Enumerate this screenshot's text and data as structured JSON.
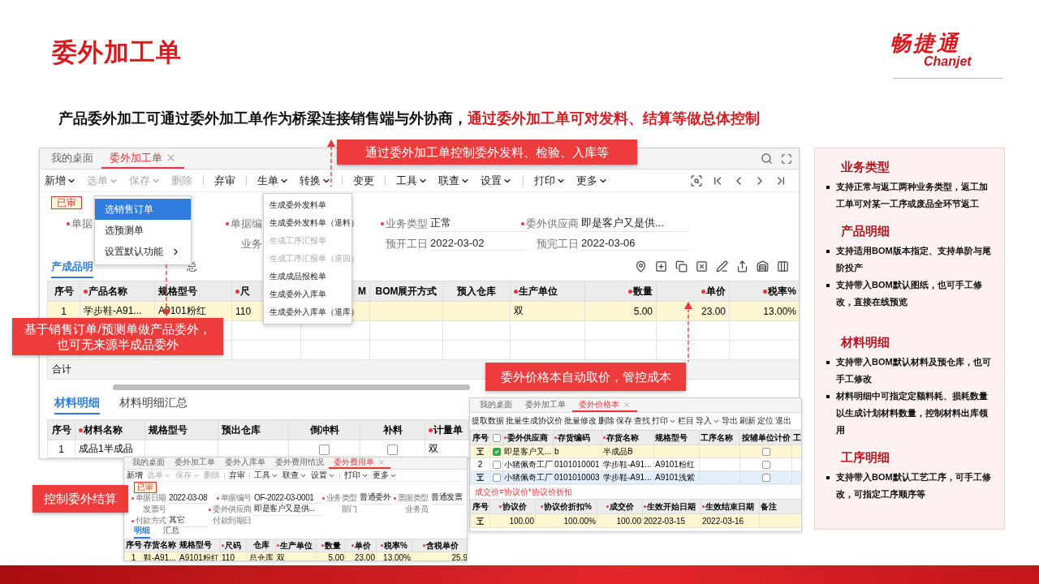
{
  "slide": {
    "title": "委外加工单",
    "logo_name": "畅捷通",
    "logo_latin": "Chanjet",
    "lead": "产品委外加工可通过委外加工单作为桥梁连接销售端与外协商，",
    "lead_highlight": "通过委外加工单可对发料、结算等做总体控制"
  },
  "main_window": {
    "tabs": [
      {
        "label": "我的桌面",
        "selected": false,
        "closable": false
      },
      {
        "label": "委外加工单",
        "selected": true,
        "closable": true
      }
    ],
    "toolbar": [
      {
        "label": "新增",
        "dropdown": true,
        "disabled": false,
        "divider": false
      },
      {
        "label": "选单",
        "dropdown": true,
        "disabled": true,
        "divider": false
      },
      {
        "label": "保存",
        "dropdown": true,
        "disabled": true,
        "divider": false
      },
      {
        "label": "删除",
        "dropdown": false,
        "disabled": true,
        "divider": true
      },
      {
        "label": "弃审",
        "dropdown": false,
        "disabled": false,
        "divider": true
      },
      {
        "label": "生单",
        "dropdown": true,
        "disabled": false,
        "divider": false
      },
      {
        "label": "转换",
        "dropdown": true,
        "disabled": false,
        "divider": true
      },
      {
        "label": "变更",
        "dropdown": false,
        "disabled": false,
        "divider": true
      },
      {
        "label": "工具",
        "dropdown": true,
        "disabled": false,
        "divider": false
      },
      {
        "label": "联查",
        "dropdown": true,
        "disabled": false,
        "divider": false
      },
      {
        "label": "设置",
        "dropdown": true,
        "disabled": false,
        "divider": true
      },
      {
        "label": "打印",
        "dropdown": true,
        "disabled": false,
        "divider": false
      },
      {
        "label": "更多",
        "dropdown": true,
        "disabled": false,
        "divider": false
      }
    ],
    "status": "已审",
    "form_columns": [
      [
        {
          "label": "单据",
          "required": true
        }
      ],
      [
        {
          "label": "单据编",
          "required": true
        },
        {
          "label": "业务",
          "required": false
        }
      ],
      [
        {
          "label": "业务类型",
          "required": true,
          "value": "正常"
        },
        {
          "label": "预开工日",
          "required": false,
          "value": "2022-03-02"
        }
      ],
      [
        {
          "label": "委外供应商",
          "required": true,
          "value": "即是客户又是供..."
        },
        {
          "label": "预完工日",
          "required": false,
          "value": "2022-03-06"
        }
      ]
    ],
    "select_menu": [
      {
        "label": "选销售订单",
        "selected": true,
        "submenu": false
      },
      {
        "label": "选预测单",
        "selected": false,
        "submenu": false
      },
      {
        "label": "设置默认功能",
        "selected": false,
        "submenu": true
      }
    ],
    "generate_menu": [
      {
        "label": "生成委外发料单",
        "disabled": false
      },
      {
        "label": "生成委外发料单（退料）",
        "disabled": false
      },
      {
        "label": "生成工序汇报单",
        "disabled": true
      },
      {
        "label": "生成工序汇报单（退回）",
        "disabled": true
      },
      {
        "label": "生成成品报检单",
        "disabled": false
      },
      {
        "label": "生成委外入库单",
        "disabled": false
      },
      {
        "label": "生成委外入库单（退库）",
        "disabled": false
      }
    ],
    "detail_tabs": [
      {
        "label": "产成品明",
        "selected": true
      },
      {
        "label": "总",
        "selected": false
      }
    ],
    "product_table": {
      "columns": [
        {
          "label": "序号",
          "required": false
        },
        {
          "label": "产品名称",
          "required": true
        },
        {
          "label": "规格型号",
          "required": false
        },
        {
          "label": "尺",
          "required": true
        },
        {
          "label": "M",
          "required": false
        },
        {
          "label": "BOM展开方式",
          "required": false
        },
        {
          "label": "预入仓库",
          "required": false
        },
        {
          "label": "生产单位",
          "required": true
        },
        {
          "label": "数量",
          "required": true
        },
        {
          "label": "单价",
          "required": true
        },
        {
          "label": "税率%",
          "required": true
        }
      ],
      "rows": [
        {
          "current": true,
          "cells": [
            "1",
            "学步鞋-A91...",
            "A9101粉红",
            "110",
            null,
            null,
            null,
            "双",
            "5.00",
            "23.00",
            "13.00%"
          ]
        }
      ],
      "total_label": "合计"
    },
    "material_tabs": [
      {
        "label": "材料明细",
        "selected": true
      },
      {
        "label": "材料明细汇总",
        "selected": false
      }
    ],
    "material_table": {
      "columns": [
        {
          "label": "序号",
          "required": false
        },
        {
          "label": "材料名称",
          "required": true
        },
        {
          "label": "规格型号",
          "required": false
        },
        {
          "label": "预出仓库",
          "required": false
        },
        {
          "label": "倒冲料",
          "required": false
        },
        {
          "label": "补料",
          "required": false
        },
        {
          "label": "计量单",
          "required": true
        }
      ],
      "rows": [
        {
          "current": false,
          "cells": [
            "1",
            "成品1半成品",
            null,
            null,
            false,
            false,
            "双"
          ]
        }
      ]
    }
  },
  "price_window": {
    "tabs": [
      {
        "label": "我的桌面",
        "selected": false,
        "closable": false
      },
      {
        "label": "委外加工单",
        "selected": false,
        "closable": false
      },
      {
        "label": "委外价格本",
        "selected": true,
        "closable": true
      }
    ],
    "toolbar": [
      {
        "label": "提取数据",
        "dropdown": false
      },
      {
        "label": "批量生成协议价",
        "dropdown": false
      },
      {
        "label": "批量修改",
        "dropdown": false
      },
      {
        "label": "删除",
        "dropdown": false
      },
      {
        "label": "保存",
        "dropdown": false
      },
      {
        "label": "查找",
        "dropdown": false
      },
      {
        "label": "打印",
        "dropdown": true
      },
      {
        "label": "栏目",
        "dropdown": false
      },
      {
        "label": "导入",
        "dropdown": true
      },
      {
        "label": "导出",
        "dropdown": false
      },
      {
        "label": "刷新",
        "dropdown": false
      },
      {
        "label": "定位",
        "dropdown": false
      },
      {
        "label": "退出",
        "dropdown": false
      }
    ],
    "price_table": {
      "columns": [
        {
          "label": "序号",
          "required": false
        },
        {
          "checked": false
        },
        {
          "label": "委外供应商",
          "required": true
        },
        {
          "label": "存货编码",
          "required": true
        },
        {
          "label": "存货名称",
          "required": true
        },
        {
          "label": "规格型号",
          "required": false
        },
        {
          "label": "工序名称",
          "required": false
        },
        {
          "label": "按辅单位计价",
          "required": false
        },
        {
          "label": "工",
          "required": false
        }
      ],
      "rows": [
        {
          "marker": true,
          "current": true,
          "selected": false,
          "cells": [
            null,
            true,
            "即是客户又...",
            "b",
            "半成品B",
            null,
            null,
            false,
            null
          ]
        },
        {
          "marker": false,
          "current": false,
          "selected": false,
          "cells": [
            "2",
            false,
            "小猪佩奇工厂",
            "0101010001",
            "学步鞋-A91...",
            "A9101粉红",
            null,
            false,
            null
          ]
        },
        {
          "marker": true,
          "current": false,
          "selected": true,
          "cells": [
            null,
            false,
            "小猪佩奇工厂",
            "0101010003",
            "学步鞋-A91...",
            "A9101浅紫",
            null,
            false,
            null
          ]
        }
      ]
    },
    "formula_note": "成交价=协议价*协议价折扣",
    "agreement_table": {
      "columns": [
        {
          "label": "序号",
          "required": false
        },
        {
          "label": "协议价",
          "required": true
        },
        {
          "label": "协议价折扣%",
          "required": true
        },
        {
          "label": "成交价",
          "required": true
        },
        {
          "label": "生效开始日期",
          "required": true
        },
        {
          "label": "生效结束日期",
          "required": true
        },
        {
          "label": "备注",
          "required": false
        }
      ],
      "rows": [
        {
          "marker": true,
          "current": true,
          "cells": [
            null,
            "100.00",
            "100.00%",
            "100.00",
            "2022-03-15",
            "2022-03-16",
            null
          ]
        }
      ]
    }
  },
  "fee_window": {
    "tabs": [
      {
        "label": "我的桌面",
        "selected": false,
        "closable": false
      },
      {
        "label": "委外加工单",
        "selected": false,
        "closable": false
      },
      {
        "label": "委外入库单",
        "selected": false,
        "closable": false
      },
      {
        "label": "委外费用情况",
        "selected": false,
        "closable": false
      },
      {
        "label": "委外费用单",
        "selected": true,
        "closable": true
      }
    ],
    "toolbar": [
      {
        "label": "新增",
        "dropdown": false,
        "disabled": false,
        "divider": false
      },
      {
        "label": "选单",
        "dropdown": true,
        "disabled": true,
        "divider": false
      },
      {
        "label": "保存",
        "dropdown": true,
        "disabled": true,
        "divider": false
      },
      {
        "label": "删除",
        "dropdown": false,
        "disabled": true,
        "divider": true
      },
      {
        "label": "弃审",
        "dropdown": false,
        "disabled": false,
        "divider": true
      },
      {
        "label": "工具",
        "dropdown": true,
        "disabled": false,
        "divider": false
      },
      {
        "label": "联查",
        "dropdown": true,
        "disabled": false,
        "divider": false
      },
      {
        "label": "设置",
        "dropdown": true,
        "disabled": false,
        "divider": true
      },
      {
        "label": "打印",
        "dropdown": true,
        "disabled": false,
        "divider": false
      },
      {
        "label": "更多",
        "dropdown": true,
        "disabled": false,
        "divider": false
      }
    ],
    "status": "已审",
    "form_columns": [
      [
        {
          "label": "单据日期",
          "required": true,
          "value": "2022-03-08"
        },
        {
          "label": "发票号",
          "required": false
        },
        {
          "label": "付款方式",
          "required": true,
          "value": "其它"
        }
      ],
      [
        {
          "label": "单据编号",
          "required": true,
          "value": "OF-2022-03-0001"
        },
        {
          "label": "委外供应商",
          "required": true,
          "value": "即是客户又是供..."
        },
        {
          "label": "付款到期日",
          "required": false
        }
      ],
      [
        {
          "label": "业务类型",
          "required": true,
          "value": "普通委外"
        },
        {
          "label": "部门",
          "required": false
        }
      ],
      [
        {
          "label": "票据类型",
          "required": true,
          "value": "普通发票"
        },
        {
          "label": "业务员",
          "required": false
        }
      ]
    ],
    "detail_tabs": [
      {
        "label": "明细",
        "selected": true
      },
      {
        "label": "汇总",
        "selected": false
      }
    ],
    "table": {
      "columns": [
        {
          "label": "序号",
          "required": false
        },
        {
          "label": "存货名称",
          "required": false
        },
        {
          "label": "规格型号",
          "required": false
        },
        {
          "label": "尺码",
          "required": true
        },
        {
          "label": "仓库",
          "required": false
        },
        {
          "label": "生产单位",
          "required": true
        },
        {
          "label": "数量",
          "required": true
        },
        {
          "label": "单价",
          "required": true
        },
        {
          "label": "税率%",
          "required": true
        },
        {
          "label": "含税单价",
          "required": true
        }
      ],
      "rows": [
        {
          "current": true,
          "cells": [
            "1",
            "鞋-A91...",
            "A9101粉红",
            "110",
            "总仓库",
            "双",
            "5.00",
            "23.00",
            "13.00%",
            "25.9"
          ]
        }
      ]
    }
  },
  "callouts": [
    {
      "text": "通过委外加工单控制委外发料、检验、入库等"
    },
    {
      "text": "基于销售订单/预测单做产品委外，也可无来源半成品委外"
    },
    {
      "text": "委外价格本自动取价，管控成本"
    },
    {
      "text": "控制委外结算"
    }
  ],
  "side_panel": {
    "sections": [
      {
        "title": "业务类型",
        "bullets": [
          "支持正常与返工两种业务类型，返工加工单可对某一工序或废品全环节返工"
        ]
      },
      {
        "title": "产品明细",
        "bullets": [
          "支持适用BOM版本指定、支持单阶与尾阶投产",
          "支持带入BOM默认图纸，也可手工修改，直接在线预览"
        ]
      },
      {
        "title": "材料明细",
        "bullets": [
          "支持带入BOM默认材料及预仓库，也可手工修改",
          "材料明细中可指定定额料耗、损耗数量以生成计划材料数量，控制材料出库领用"
        ]
      },
      {
        "title": "工序明细",
        "bullets": [
          "支持带入BOM默认工艺工序，可手工修改，可指定工序顺序等"
        ]
      }
    ]
  }
}
